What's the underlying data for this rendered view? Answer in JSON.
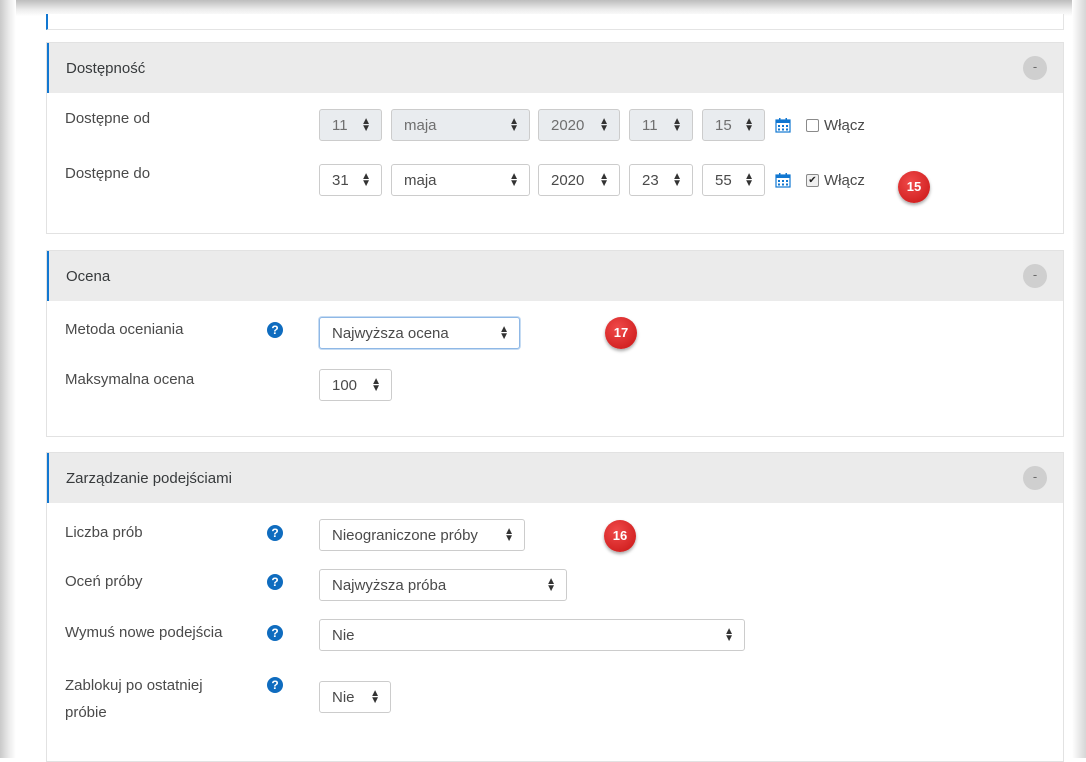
{
  "sections": {
    "dostepnosc": {
      "title": "Dostępność",
      "collapse": "-",
      "from": {
        "label": "Dostępne od",
        "day": "11",
        "month": "maja",
        "year": "2020",
        "hour": "11",
        "minute": "15",
        "enable_label": "Włącz",
        "enabled": false
      },
      "to": {
        "label": "Dostępne do",
        "day": "31",
        "month": "maja",
        "year": "2020",
        "hour": "23",
        "minute": "55",
        "enable_label": "Włącz",
        "enabled": true
      },
      "badge": "15"
    },
    "ocena": {
      "title": "Ocena",
      "collapse": "-",
      "method_label": "Metoda oceniania",
      "method_value": "Najwyższa ocena",
      "max_label": "Maksymalna ocena",
      "max_value": "100",
      "badge": "17"
    },
    "podejscia": {
      "title": "Zarządzanie podejściami",
      "collapse": "-",
      "attempts_label": "Liczba prób",
      "attempts_value": "Nieograniczone próby",
      "grade_label": "Oceń próby",
      "grade_value": "Najwyższa próba",
      "force_label": "Wymuś nowe podejścia",
      "force_value": "Nie",
      "lock_label_1": "Zablokuj po ostatniej",
      "lock_label_2": "próbie",
      "lock_value": "Nie",
      "badge": "16"
    }
  },
  "icons": {
    "help": "question-circle-icon",
    "calendar": "calendar-icon",
    "collapse": "minus-circle-icon"
  },
  "colors": {
    "accent": "#0f6cbf",
    "badge": "#d71a1a",
    "header": "#ebebeb"
  }
}
